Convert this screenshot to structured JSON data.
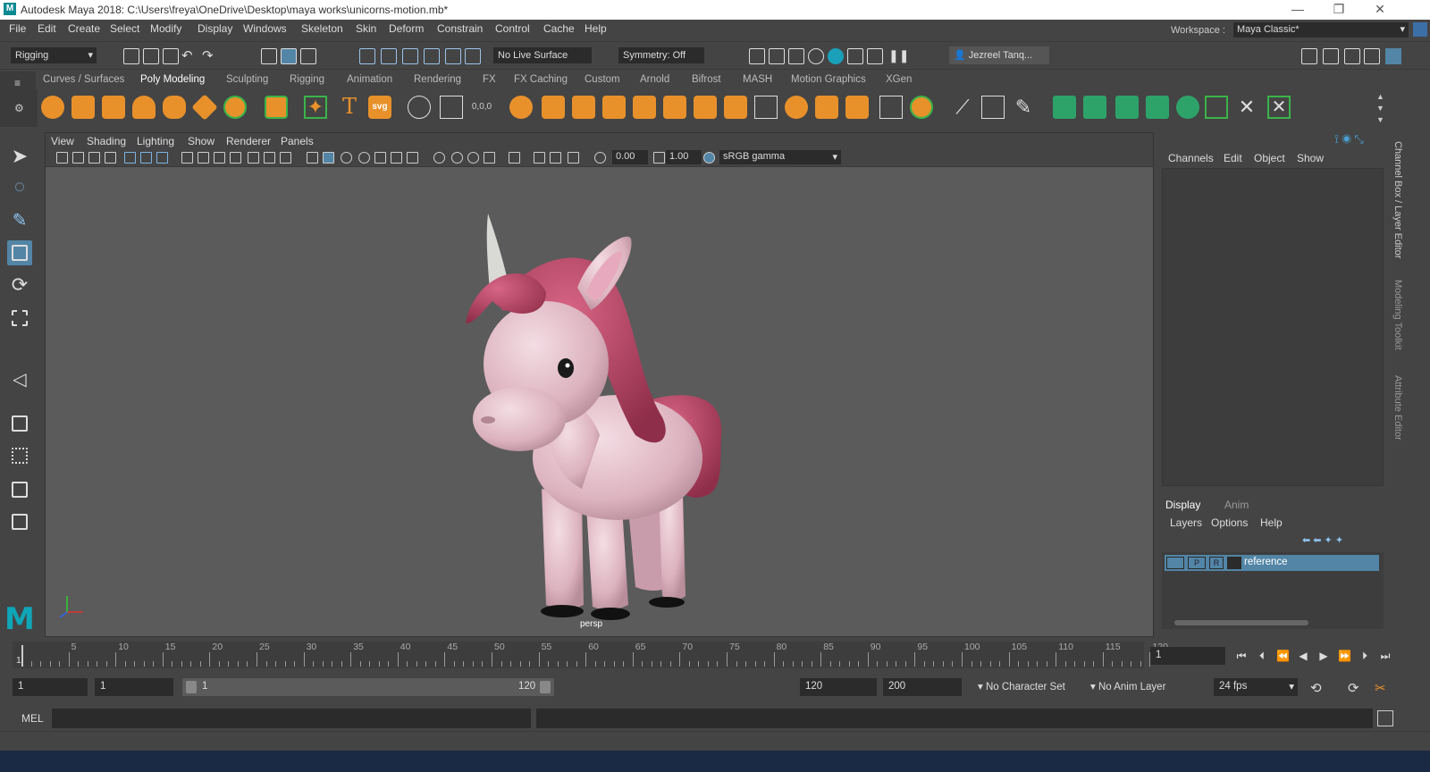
{
  "window": {
    "title": "Autodesk Maya 2018: C:\\Users\\freya\\OneDrive\\Desktop\\maya works\\unicorns-motion.mb*",
    "logo": "M"
  },
  "menubar": {
    "items": [
      "File",
      "Edit",
      "Create",
      "Select",
      "Modify",
      "Display",
      "Windows",
      "Skeleton",
      "Skin",
      "Deform",
      "Constrain",
      "Control",
      "Cache",
      "Help"
    ],
    "workspace_label": "Workspace :",
    "workspace_value": "Maya Classic*"
  },
  "statusline": {
    "menuset": "Rigging",
    "live_surface": "No Live Surface",
    "symmetry": "Symmetry: Off",
    "user": "Jezreel Tanq..."
  },
  "shelf": {
    "tabs": [
      "Curves / Surfaces",
      "Poly Modeling",
      "Sculpting",
      "Rigging",
      "Animation",
      "Rendering",
      "FX",
      "FX Caching",
      "Custom",
      "Arnold",
      "Bifrost",
      "MASH",
      "Motion Graphics",
      "XGen"
    ],
    "active_tab": "Poly Modeling",
    "text_icon": "T",
    "svg_icon": "svg",
    "coord_icon": "0,0,0"
  },
  "viewport": {
    "menus": [
      "View",
      "Shading",
      "Lighting",
      "Show",
      "Renderer",
      "Panels"
    ],
    "exposure": "0.00",
    "gamma": "1.00",
    "colorspace": "sRGB gamma",
    "camera": "persp"
  },
  "channelbox": {
    "menus": [
      "Channels",
      "Edit",
      "Object",
      "Show"
    ],
    "layer_tabs": [
      "Display",
      "Anim"
    ],
    "layer_menus": [
      "Layers",
      "Options",
      "Help"
    ],
    "layer": {
      "p": "P",
      "r": "R",
      "name": "reference"
    }
  },
  "side_tabs": [
    "Channel Box / Layer Editor",
    "Modeling Toolkit",
    "Attribute Editor"
  ],
  "timeslider": {
    "ticks": [
      "5",
      "10",
      "15",
      "20",
      "25",
      "30",
      "35",
      "40",
      "45",
      "50",
      "55",
      "60",
      "65",
      "70",
      "75",
      "80",
      "85",
      "90",
      "95",
      "100",
      "105",
      "110",
      "115",
      "120"
    ],
    "start_label": "1",
    "current_frame": "1"
  },
  "rangebar": {
    "start": "1",
    "playback_start": "1",
    "range_start": "1",
    "range_end": "120",
    "playback_end": "120",
    "end": "200",
    "character_set": "No Character Set",
    "anim_layer": "No Anim Layer",
    "fps": "24 fps"
  },
  "cmdline": {
    "label": "MEL"
  },
  "colors": {
    "accent": "#5285a6",
    "shelf_orange": "#e8912b",
    "shelf_green": "#2da36a",
    "maya_teal": "#0fa6b7",
    "viewport_bg": "#5b5b5b"
  }
}
